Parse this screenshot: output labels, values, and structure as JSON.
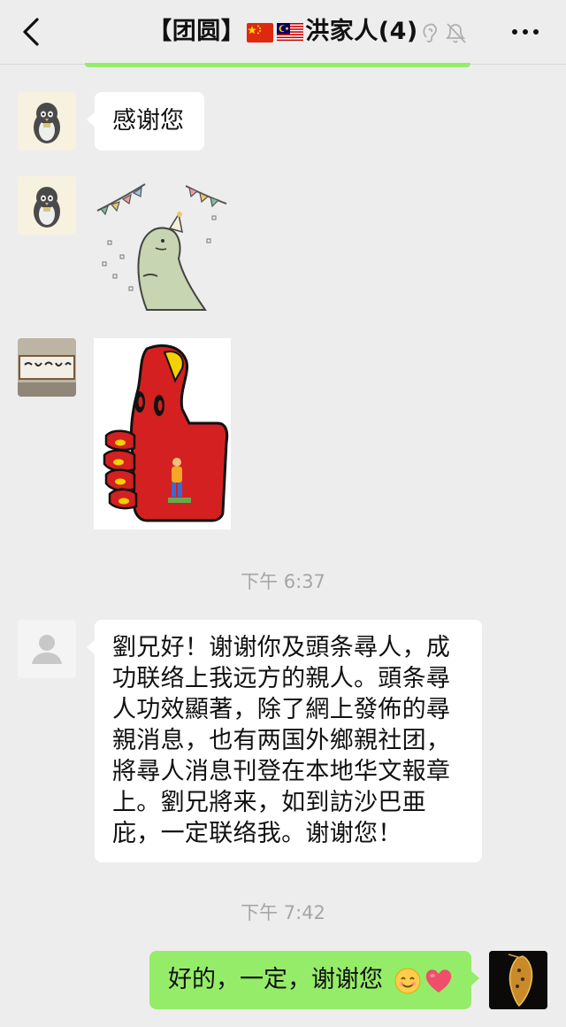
{
  "header": {
    "title_prefix": "【团圆】",
    "title_name": "洪家人",
    "member_count": "(4)",
    "flags": [
      "china-flag",
      "malaysia-flag"
    ],
    "icons": [
      "ear-icon",
      "mute-bell-icon",
      "more-icon"
    ]
  },
  "messages": [
    {
      "side": "left",
      "type": "text",
      "avatar": "penguin-avatar",
      "text": "感谢您"
    },
    {
      "side": "left",
      "type": "sticker",
      "avatar": "penguin-avatar",
      "sticker": "dinosaur-party-sticker"
    },
    {
      "side": "left",
      "type": "sticker",
      "avatar": "calligraphy-avatar",
      "sticker": "thumbs-up-sticker"
    },
    {
      "type": "timestamp",
      "text": "下午 6:37"
    },
    {
      "side": "left",
      "type": "text",
      "avatar": "default-avatar",
      "lines": [
        "劉兄好！谢谢你及頭条尋人，成",
        "功联络上我远方的親人。頭条尋",
        "人功效顯著，除了網上發佈的尋",
        "親消息，也有两国外鄉親社团，",
        "將尋人消息刊登在本地华文報章",
        "上。劉兄將来，如到訪沙巴亜",
        "庇，一定联络我。谢谢您！"
      ]
    },
    {
      "type": "timestamp",
      "text": "下午 7:42"
    },
    {
      "side": "right",
      "type": "text",
      "avatar": "taiwan-pendant-avatar",
      "text": "好的，一定，谢谢您",
      "emoji": [
        "smiling-face-emoji",
        "red-heart-emoji"
      ]
    }
  ],
  "colors": {
    "background": "#ededed",
    "bubble_left": "#ffffff",
    "bubble_right": "#95ec69",
    "timestamp": "#a6a6a6"
  }
}
